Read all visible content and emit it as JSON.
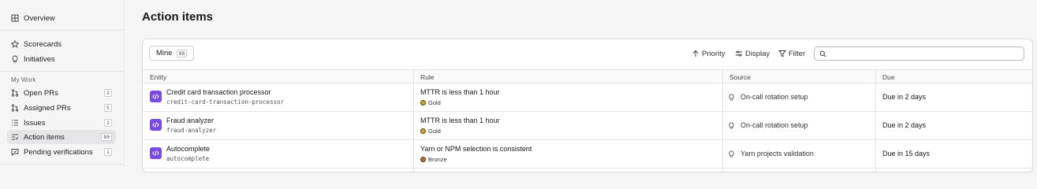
{
  "sidebar": {
    "overview": "Overview",
    "scorecards": "Scorecards",
    "initiatives": "Initiatives",
    "section_label": "My Work",
    "open_prs": {
      "label": "Open PRs",
      "count": "2"
    },
    "assigned_prs": {
      "label": "Assigned PRs",
      "count": "5"
    },
    "issues": {
      "label": "Issues",
      "count": "2"
    },
    "action_items": {
      "label": "Action items",
      "count": "80"
    },
    "pending_verifications": {
      "label": "Pending verifications",
      "count": "1"
    }
  },
  "main": {
    "title": "Action items",
    "toolbar": {
      "mine_label": "Mine",
      "mine_count": "80",
      "priority_label": "Priority",
      "display_label": "Display",
      "filter_label": "Filter",
      "search_value": ""
    },
    "table": {
      "columns": {
        "entity": "Entity",
        "rule": "Rule",
        "source": "Source",
        "due": "Due"
      },
      "rows": [
        {
          "entity_name": "Credit card transaction processor",
          "entity_tag": "credit-card-transaction-processor",
          "rule_name": "MTTR is less than 1 hour",
          "rule_level": "Gold",
          "source": "On-call rotation setup",
          "due": "Due in 2 days"
        },
        {
          "entity_name": "Fraud analyzer",
          "entity_tag": "fraud-analyzer",
          "rule_name": "MTTR is less than 1 hour",
          "rule_level": "Gold",
          "source": "On-call rotation setup",
          "due": "Due in 2 days"
        },
        {
          "entity_name": "Autocomplete",
          "entity_tag": "autocomplete",
          "rule_name": "Yarn or NPM selection is consistent",
          "rule_level": "Bronze",
          "source": "Yarn projects validation",
          "due": "Due in 15 days"
        }
      ]
    }
  },
  "colors": {
    "entity_icon": "#7b4ae2",
    "gold": "#c9a227",
    "bronze": "#b9733f",
    "active_nav": "#e6e6e9"
  },
  "icons": {
    "overview": "grid-icon",
    "scorecards": "star-icon",
    "initiatives": "lightbulb-icon",
    "open_prs": "pull-request-icon",
    "assigned_prs": "pull-request-icon",
    "issues": "list-icon",
    "action_items": "checklist-icon",
    "pending_verifications": "message-check-icon",
    "entity": "code-icon",
    "source": "lightbulb-icon",
    "search": "search-icon"
  }
}
